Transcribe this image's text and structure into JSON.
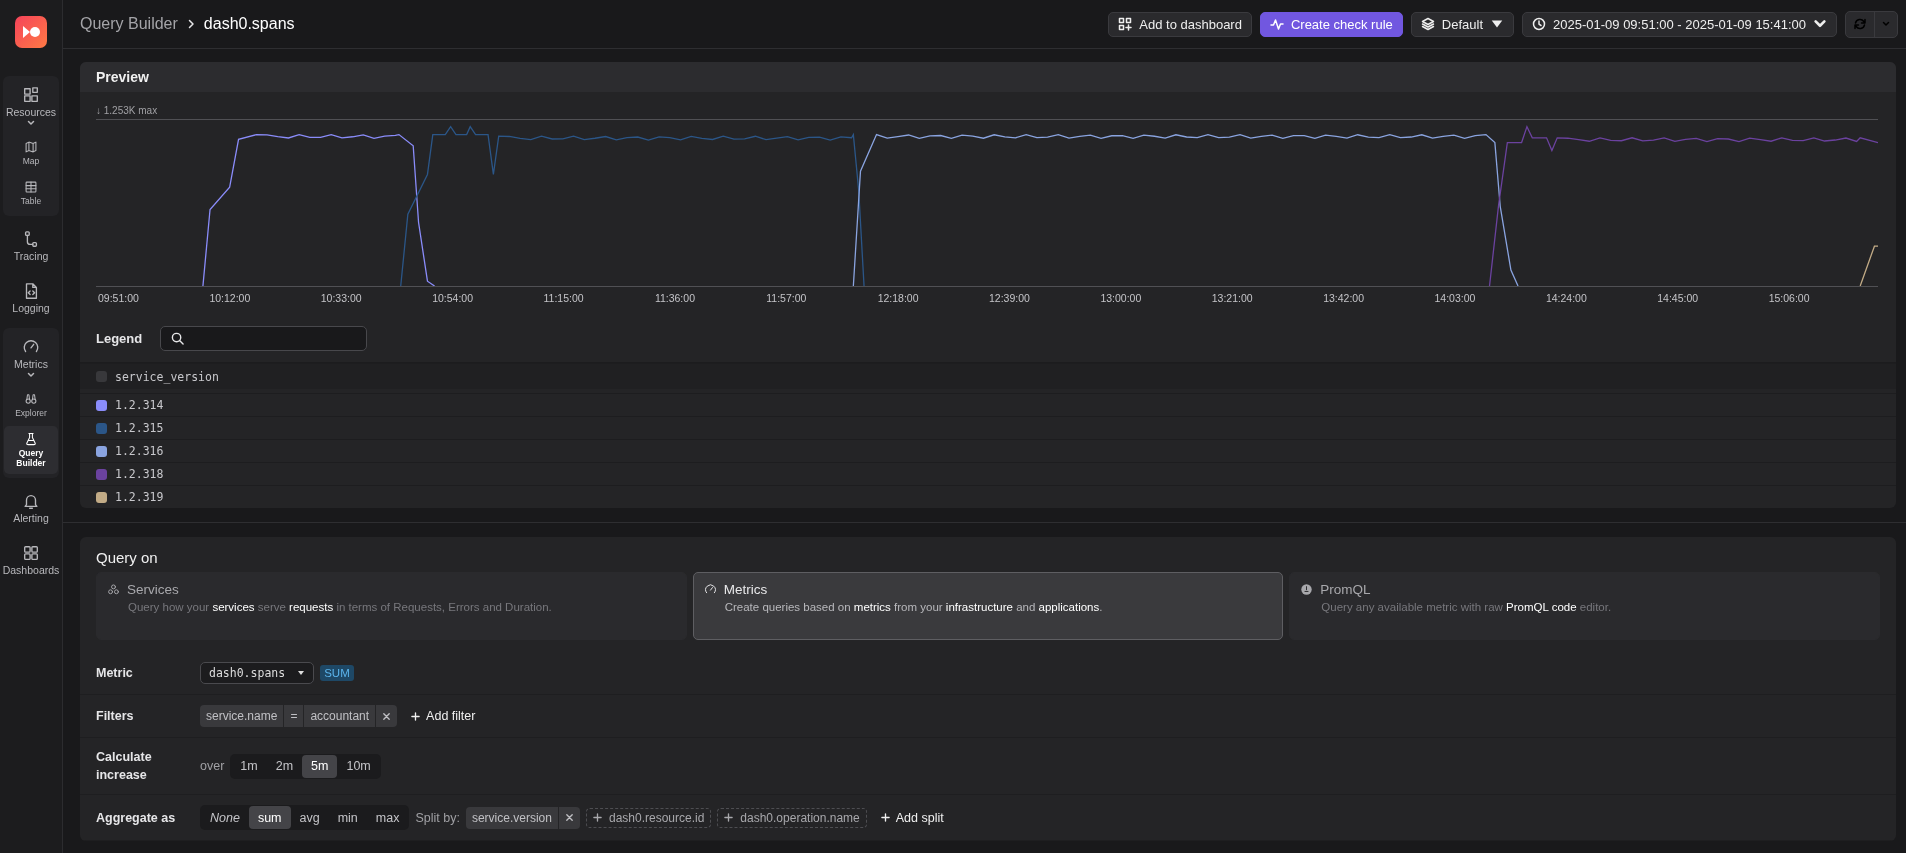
{
  "sidebar": {
    "items": [
      {
        "label": "Resources",
        "expanded": true,
        "selected": false,
        "children": [
          {
            "label": "Map",
            "selected": false
          },
          {
            "label": "Table",
            "selected": false
          }
        ]
      },
      {
        "label": "Tracing",
        "selected": false
      },
      {
        "label": "Logging",
        "selected": false
      },
      {
        "label": "Metrics",
        "expanded": true,
        "selected": false,
        "children": [
          {
            "label": "Explorer",
            "selected": false
          },
          {
            "label": "Query Builder",
            "selected": true
          }
        ]
      },
      {
        "label": "Alerting",
        "selected": false
      },
      {
        "label": "Dashboards",
        "selected": false
      }
    ]
  },
  "breadcrumb": [
    "Query Builder",
    "dash0.spans"
  ],
  "toolbar": {
    "add_to_dashboard": "Add to dashboard",
    "create_check_rule": "Create check rule",
    "view": "Default",
    "time_range": "2025-01-09 09:51:00 - 2025-01-09 15:41:00"
  },
  "preview": {
    "title": "Preview",
    "max_label": "↓ 1.253K max",
    "x_labels": [
      "09:51:00",
      "10:12:00",
      "10:33:00",
      "10:54:00",
      "11:15:00",
      "11:36:00",
      "11:57:00",
      "12:18:00",
      "12:39:00",
      "13:00:00",
      "13:21:00",
      "13:42:00",
      "14:03:00",
      "14:24:00",
      "14:45:00",
      "15:06:00"
    ],
    "legend": {
      "label": "Legend",
      "header": "service_version",
      "checked": false,
      "items": [
        {
          "name": "1.2.314",
          "color": "#8a8cfa"
        },
        {
          "name": "1.2.315",
          "color": "#2b5688"
        },
        {
          "name": "1.2.316",
          "color": "#8aa4e0"
        },
        {
          "name": "1.2.318",
          "color": "#6b429f"
        },
        {
          "name": "1.2.319",
          "color": "#c2ab86"
        }
      ]
    }
  },
  "query_on": {
    "title": "Query on",
    "options": [
      {
        "title": "Services",
        "description": "Query how your **services** serve **requests** in terms of Requests, Errors and Duration.",
        "selected": false
      },
      {
        "title": "Metrics",
        "description": "Create queries based on **metrics** from your **infrastructure** and **applications**.",
        "selected": true
      },
      {
        "title": "PromQL",
        "description": "Query any available metric with raw **PromQL code** editor.",
        "selected": false
      }
    ],
    "metric": {
      "label": "Metric",
      "value": "dash0.spans",
      "badge": "SUM"
    },
    "filters": {
      "label": "Filters",
      "items": [
        {
          "key": "service.name",
          "operator": "=",
          "value": "accountant"
        }
      ],
      "add": "Add filter"
    },
    "increase": {
      "label": "Calculate increase",
      "prefix": "over",
      "options": [
        {
          "label": "1m",
          "selected": false
        },
        {
          "label": "2m",
          "selected": false
        },
        {
          "label": "5m",
          "selected": true
        },
        {
          "label": "10m",
          "selected": false
        }
      ]
    },
    "aggregate": {
      "label": "Aggregate as",
      "options": [
        {
          "label": "None",
          "selected": false
        },
        {
          "label": "sum",
          "selected": true
        },
        {
          "label": "avg",
          "selected": false
        },
        {
          "label": "min",
          "selected": false
        },
        {
          "label": "max",
          "selected": false
        }
      ],
      "split_label": "Split by:",
      "splits": [
        {
          "label": "service.version",
          "active": true
        },
        {
          "label": "dash0.resource.id",
          "active": false
        },
        {
          "label": "dash0.operation.name",
          "active": false
        }
      ],
      "add_split": "Add split"
    }
  }
}
